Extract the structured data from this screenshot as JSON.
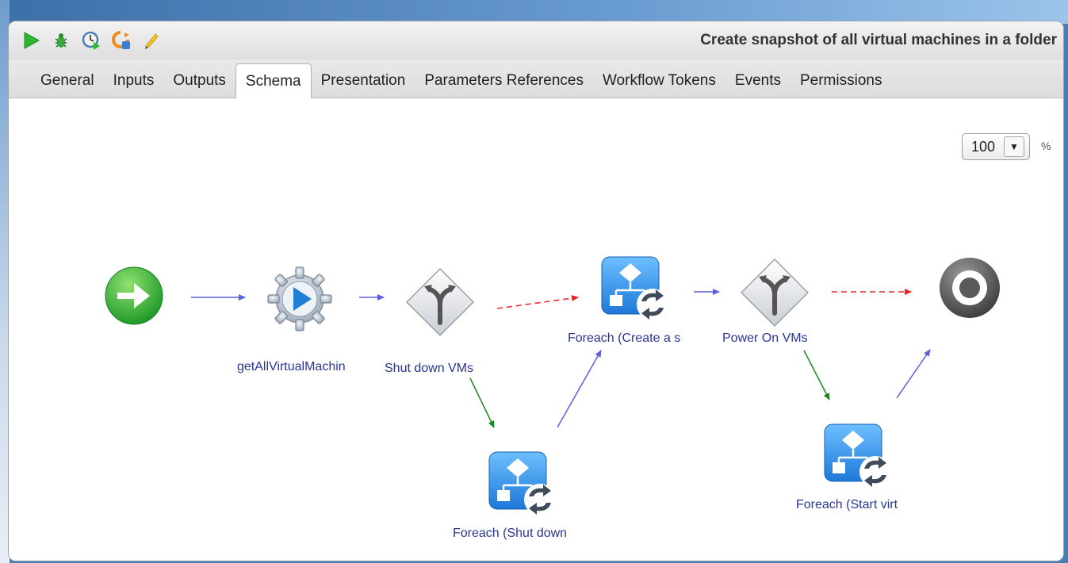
{
  "window": {
    "title": "Create snapshot of all virtual machines in a folder"
  },
  "toolbar": {
    "buttons": [
      {
        "name": "run-icon"
      },
      {
        "name": "debug-icon"
      },
      {
        "name": "schedule-icon"
      },
      {
        "name": "validate-icon"
      },
      {
        "name": "edit-icon"
      }
    ]
  },
  "tabs": [
    "General",
    "Inputs",
    "Outputs",
    "Schema",
    "Presentation",
    "Parameters References",
    "Workflow Tokens",
    "Events",
    "Permissions"
  ],
  "active_tab": "Schema",
  "zoom": {
    "value": "100",
    "unit": "%"
  },
  "schema": {
    "nodes": {
      "start": {
        "type": "start"
      },
      "get_vms": {
        "type": "scriptable-task",
        "label": "getAllVirtualMachin"
      },
      "shut_down_decision": {
        "type": "decision",
        "label": "Shut down VMs"
      },
      "foreach_shut_down": {
        "type": "foreach",
        "label": "Foreach (Shut down"
      },
      "foreach_create": {
        "type": "foreach",
        "label": "Foreach (Create a s"
      },
      "power_on_decision": {
        "type": "decision",
        "label": "Power On VMs"
      },
      "foreach_start": {
        "type": "foreach",
        "label": "Foreach (Start virt"
      },
      "end": {
        "type": "end"
      }
    },
    "link_colors": {
      "default": "#5a5fe0",
      "true": "#1a8a1a",
      "false": "#ee2222"
    }
  }
}
